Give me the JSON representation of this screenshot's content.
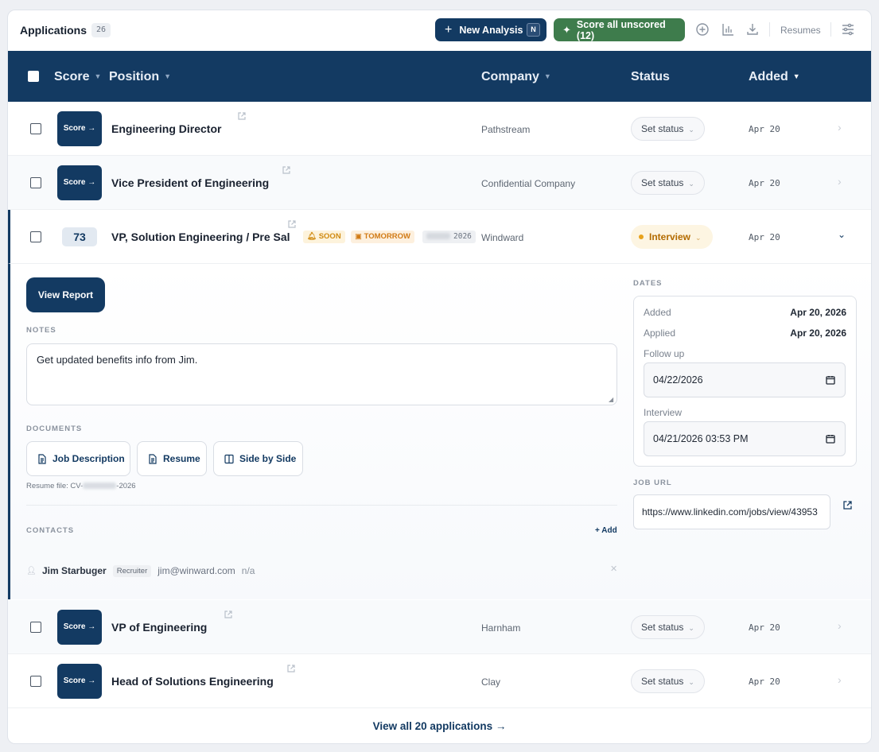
{
  "header": {
    "title": "Applications",
    "count": "26",
    "new_analysis_label": "New Analysis",
    "new_analysis_shortcut": "N",
    "score_all_label": "Score all unscored (12)",
    "resumes_label": "Resumes"
  },
  "columns": {
    "score": "Score",
    "position": "Position",
    "company": "Company",
    "status": "Status",
    "added": "Added"
  },
  "rows": [
    {
      "score_label": "Score →",
      "position": "Engineering Director",
      "company": "Pathstream",
      "status": "Set status",
      "added": "Apr 20"
    },
    {
      "score_label": "Score →",
      "position": "Vice President of Engineering",
      "company": "Confidential Company",
      "status": "Set status",
      "added": "Apr 20"
    },
    {
      "score": "73",
      "position": "VP, Solution Engineering / Pre Sal",
      "tag_soon": "SOON",
      "tag_tomorrow": "TOMORROW",
      "tag_year": "2026",
      "company": "Windward",
      "status": "Interview",
      "added": "Apr 20"
    },
    {
      "score_label": "Score →",
      "position": "VP of Engineering",
      "company": "Harnham",
      "status": "Set status",
      "added": "Apr 20"
    },
    {
      "score_label": "Score →",
      "position": "Head of Solutions Engineering",
      "company": "Clay",
      "status": "Set status",
      "added": "Apr 20"
    }
  ],
  "detail": {
    "view_report_label": "View Report",
    "notes_label": "NOTES",
    "notes_value": "Get updated benefits info from Jim.",
    "documents_label": "DOCUMENTS",
    "doc_job_description": "Job Description",
    "doc_resume": "Resume",
    "doc_side_by_side": "Side by Side",
    "resume_file_prefix": "Resume file: CV-",
    "resume_file_suffix": "-2026",
    "contacts_label": "CONTACTS",
    "add_contact_label": "+ Add",
    "contact": {
      "name": "Jim Starbuger",
      "role": "Recruiter",
      "email": "jim@winward.com",
      "phone": "n/a"
    },
    "dates_label": "DATES",
    "added_key": "Added",
    "added_value": "Apr 20, 2026",
    "applied_key": "Applied",
    "applied_value": "Apr 20, 2026",
    "follow_up_key": "Follow up",
    "follow_up_value": "04/22/2026",
    "interview_key": "Interview",
    "interview_value": "04/21/2026 03:53 PM",
    "job_url_label": "JOB URL",
    "job_url_value": "https://www.linkedin.com/jobs/view/43953"
  },
  "footer": {
    "view_all_label": "View all 20 applications →"
  },
  "colors": {
    "navy": "#133a62",
    "green": "#3e7c4c",
    "amber": "#e8a21c"
  },
  "icons": {
    "new": "plus-icon",
    "score_all": "sparkles-icon",
    "add": "plus-circle-icon",
    "stats": "bar-chart-icon",
    "download": "download-icon",
    "settings": "sliders-icon"
  }
}
